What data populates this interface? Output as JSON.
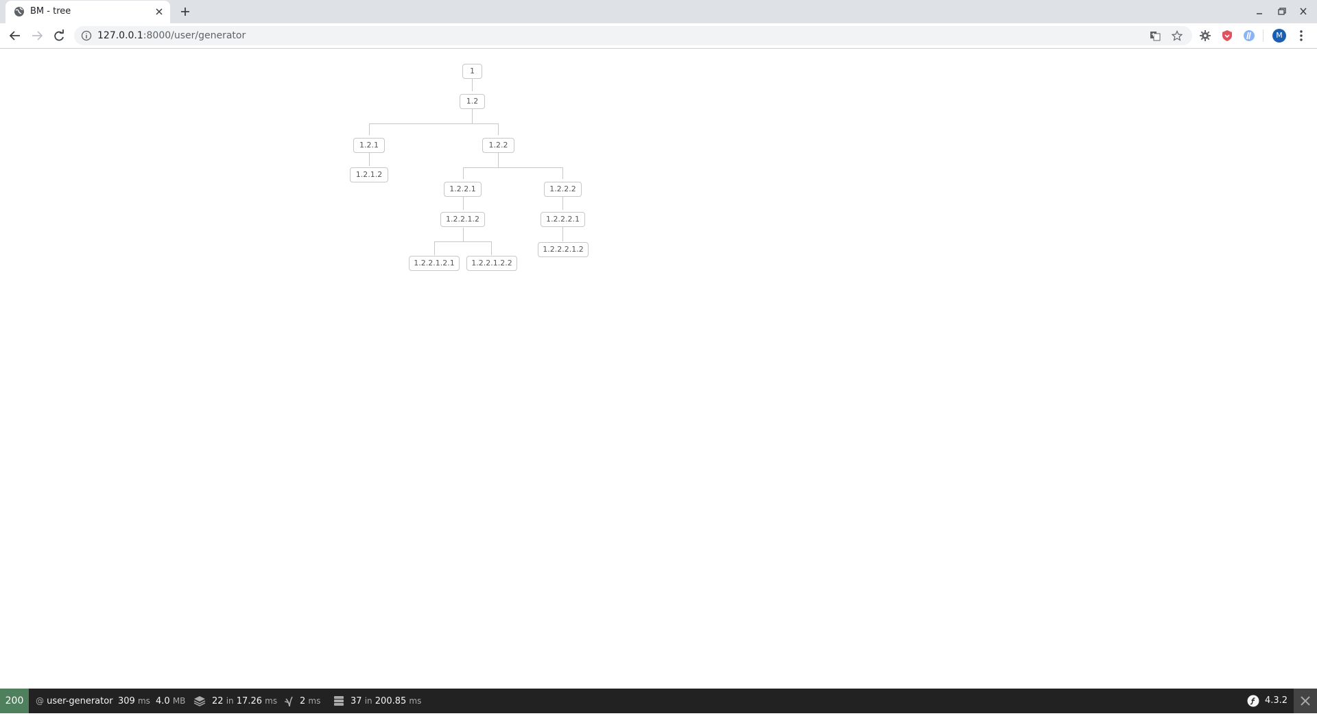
{
  "tab": {
    "title": "BM - tree",
    "icon": "globe-icon"
  },
  "address": {
    "host": "127.0.0.1",
    "path": ":8000/user/generator"
  },
  "profile": {
    "initial": "M"
  },
  "tree": {
    "root": "1",
    "n_1_2": "1.2",
    "n_1_2_1": "1.2.1",
    "n_1_2_2": "1.2.2",
    "n_1_2_1_2": "1.2.1.2",
    "n_1_2_2_1": "1.2.2.1",
    "n_1_2_2_2": "1.2.2.2",
    "n_1_2_2_1_2": "1.2.2.1.2",
    "n_1_2_2_2_1": "1.2.2.2.1",
    "n_1_2_2_1_2_1": "1.2.2.1.2.1",
    "n_1_2_2_1_2_2": "1.2.2.1.2.2",
    "n_1_2_2_2_1_2": "1.2.2.2.1.2"
  },
  "debugbar": {
    "status_code": "200",
    "route_at": "@",
    "route": "user-generator",
    "time_value": "309",
    "time_unit": "ms",
    "memory_value": "4.0",
    "memory_unit": "MB",
    "cache_count": "22",
    "cache_in": "in",
    "cache_time": "17.26",
    "cache_unit": "ms",
    "twig_time": "2",
    "twig_unit": "ms",
    "db_count": "37",
    "db_in": "in",
    "db_time": "200.85",
    "db_unit": "ms",
    "symfony_version": "4.3.2"
  },
  "colors": {
    "status_ok": "#4f805d",
    "debugbar_bg": "#222222"
  }
}
